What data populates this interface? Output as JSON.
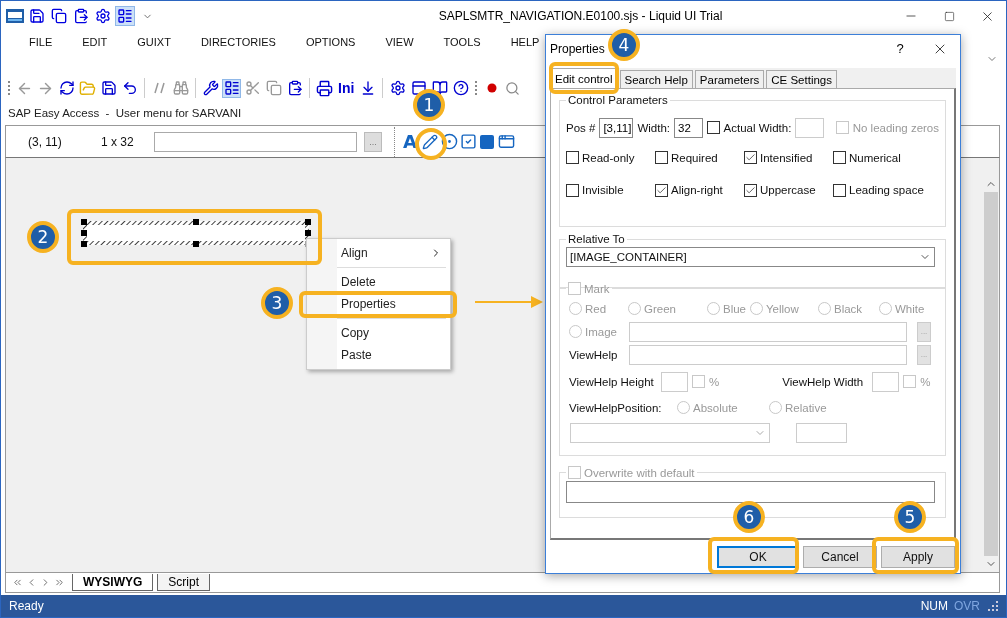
{
  "window": {
    "title": "SAPLSMTR_NAVIGATION.E0100.sjs - Liquid UI Trial"
  },
  "menu": [
    {
      "label": "FILE"
    },
    {
      "label": "EDIT"
    },
    {
      "label": "GUIXT"
    },
    {
      "label": "DIRECTORIES"
    },
    {
      "label": "OPTIONS"
    },
    {
      "label": "VIEW"
    },
    {
      "label": "TOOLS"
    },
    {
      "label": "HELP"
    }
  ],
  "toolbar": {
    "ini_label": "Ini"
  },
  "screen_title": "SAP Easy Access  -  User menu for SARVANI",
  "info_bar": {
    "position": "(3, 11)",
    "size": "1 x 32",
    "browse": "..."
  },
  "palette": {
    "text_tool": "A"
  },
  "context_menu": {
    "items": [
      {
        "label": "Align",
        "submenu": true,
        "separator_after": true
      },
      {
        "label": "Delete",
        "submenu": false,
        "separator_after": false
      },
      {
        "label": "Properties",
        "submenu": false,
        "separator_after": true
      },
      {
        "label": "Copy",
        "submenu": false,
        "separator_after": false
      },
      {
        "label": "Paste",
        "submenu": false,
        "separator_after": false
      }
    ]
  },
  "dialog": {
    "title": "Properties",
    "help": "?",
    "tabs": [
      {
        "label": "Edit control",
        "selected": true
      },
      {
        "label": "Search Help",
        "selected": false
      },
      {
        "label": "Parameters",
        "selected": false
      },
      {
        "label": "CE Settings",
        "selected": false
      }
    ],
    "control_parameters": {
      "title": "Control Parameters",
      "pos_label": "Pos #",
      "pos_value": "[3,11]",
      "width_label": "Width:",
      "width_value": "32",
      "actual_width": {
        "label": "Actual Width:",
        "checked": false
      },
      "no_leading_zeros": {
        "label": "No leading zeros",
        "checked": false,
        "disabled": true
      },
      "options": [
        {
          "label": "Read-only",
          "checked": false
        },
        {
          "label": "Required",
          "checked": false
        },
        {
          "label": "Intensified",
          "checked": true
        },
        {
          "label": "Numerical",
          "checked": false
        },
        {
          "label": "Invisible",
          "checked": false
        },
        {
          "label": "Align-right",
          "checked": true
        },
        {
          "label": "Uppercase",
          "checked": true
        },
        {
          "label": "Leading space",
          "checked": false
        }
      ]
    },
    "relative_to": {
      "title": "Relative To",
      "value": "[IMAGE_CONTAINER]"
    },
    "mark": {
      "label": "Mark",
      "checked": false,
      "disabled": true,
      "colors": [
        {
          "label": "Red",
          "selected": false
        },
        {
          "label": "Green",
          "selected": false
        },
        {
          "label": "Blue",
          "selected": false
        },
        {
          "label": "Yellow",
          "selected": false
        },
        {
          "label": "Black",
          "selected": false
        },
        {
          "label": "White",
          "selected": false
        }
      ],
      "image": {
        "label": "Image",
        "selected": false,
        "browse": "..."
      },
      "viewhelp": {
        "label": "ViewHelp",
        "browse": "..."
      },
      "height": {
        "label": "ViewHelp Height",
        "percent_checked": false,
        "percent": "%"
      },
      "width": {
        "label": "ViewHelp Width",
        "percent_checked": false,
        "percent": "%"
      },
      "position": {
        "label": "ViewHelpPosition:",
        "options": [
          {
            "label": "Absolute",
            "selected": false
          },
          {
            "label": "Relative",
            "selected": false
          }
        ]
      }
    },
    "overwrite": {
      "label": "Overwrite with default",
      "checked": false,
      "disabled": true
    },
    "buttons": [
      {
        "label": "OK",
        "default": true
      },
      {
        "label": "Cancel",
        "default": false
      },
      {
        "label": "Apply",
        "default": false
      }
    ]
  },
  "editor_tabs": [
    {
      "label": "WYSIWYG",
      "selected": true
    },
    {
      "label": "Script",
      "selected": false
    }
  ],
  "status_bar": {
    "text": "Ready",
    "indicators": [
      {
        "label": "NUM",
        "active": true
      },
      {
        "label": "OVR",
        "active": false
      }
    ]
  },
  "callouts": [
    {
      "number": "1"
    },
    {
      "number": "2"
    },
    {
      "number": "3"
    },
    {
      "number": "4"
    },
    {
      "number": "5"
    },
    {
      "number": "6"
    }
  ]
}
